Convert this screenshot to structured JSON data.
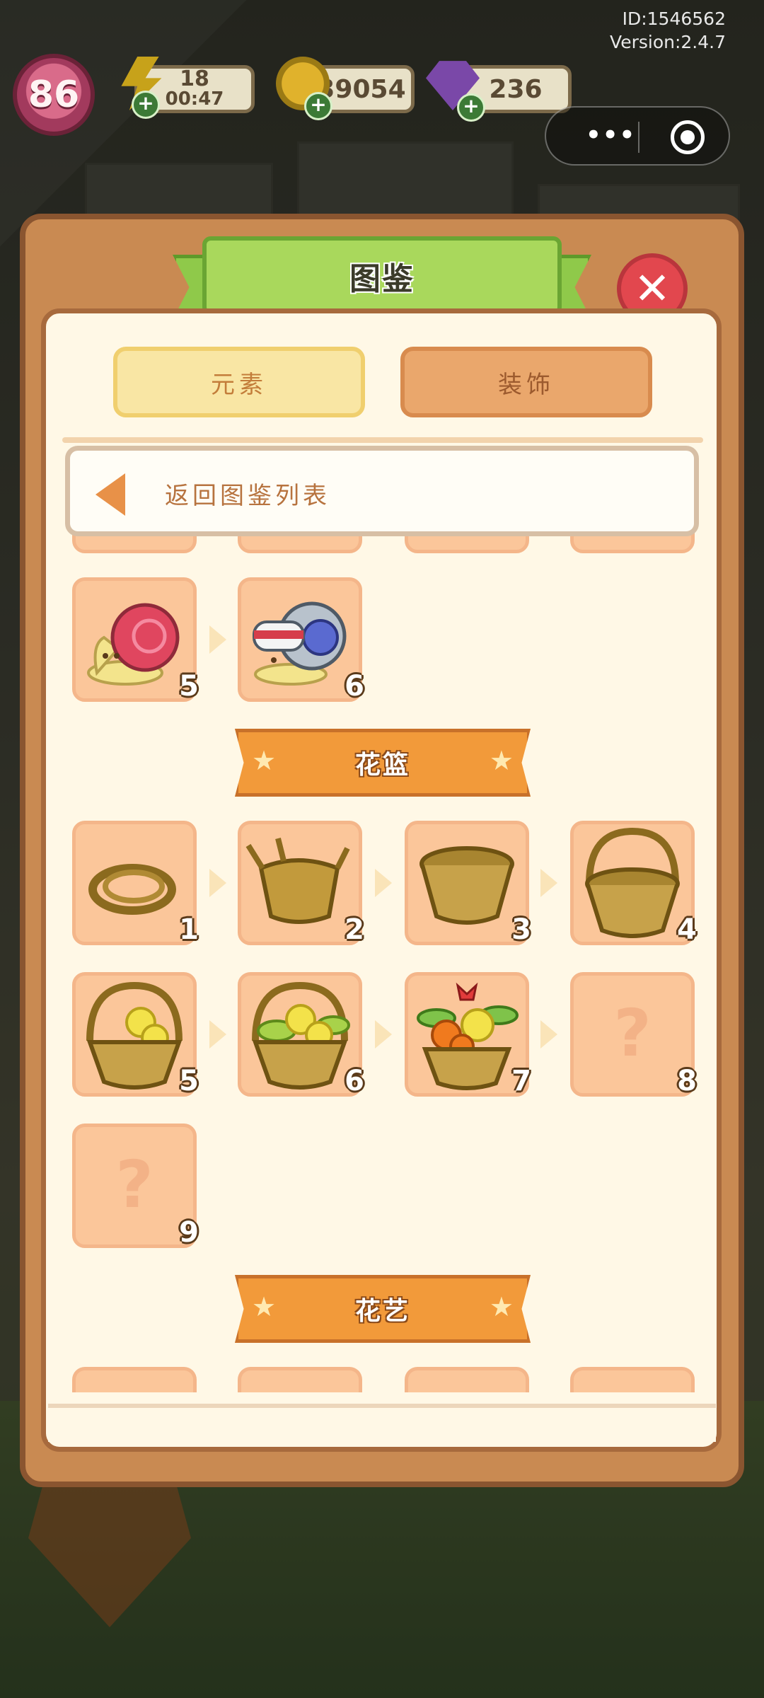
{
  "hud": {
    "id_label": "ID:1546562",
    "version_label": "Version:2.4.7",
    "level": "86",
    "energy_value": "18",
    "energy_timer": "00:47",
    "coins": "39054",
    "gems": "236"
  },
  "miniprogram_capsule": {
    "more_glyph": "•••",
    "close_icon": "target-icon"
  },
  "codex": {
    "title": "图鉴",
    "close_glyph": "✕",
    "tabs": [
      {
        "label": "元素",
        "active": true
      },
      {
        "label": "装饰",
        "active": false
      }
    ],
    "back_label": "返回图鉴列表",
    "snail_row": [
      {
        "level": "5",
        "icon": "snail-pink-shell-icon"
      },
      {
        "level": "6",
        "icon": "snail-helmet-icon"
      }
    ],
    "sections": [
      {
        "name": "花篮",
        "items": [
          {
            "level": "1",
            "icon": "twig-bundle-icon",
            "unlocked": true
          },
          {
            "level": "2",
            "icon": "unfinished-basket-icon",
            "unlocked": true
          },
          {
            "level": "3",
            "icon": "basket-bowl-icon",
            "unlocked": true
          },
          {
            "level": "4",
            "icon": "handled-basket-icon",
            "unlocked": true
          },
          {
            "level": "5",
            "icon": "basket-yellow-flowers-icon",
            "unlocked": true
          },
          {
            "level": "6",
            "icon": "basket-flowers-leaves-icon",
            "unlocked": true
          },
          {
            "level": "7",
            "icon": "flower-bouquet-basket-icon",
            "unlocked": true
          },
          {
            "level": "8",
            "icon": "question-mark-icon",
            "unlocked": false
          },
          {
            "level": "9",
            "icon": "question-mark-icon",
            "unlocked": false
          }
        ]
      },
      {
        "name": "花艺",
        "items": []
      }
    ],
    "locked_glyph": "?"
  },
  "colors": {
    "panel_bg": "#c98a52",
    "inner_bg": "#fff8e6",
    "tile_bg": "#fbc69a",
    "title_banner": "#a9d85c",
    "section_banner": "#f29a3a",
    "close_button": "#e2474e",
    "tab_active": "#f9e6a4",
    "tab_inactive": "#eaa76c"
  }
}
